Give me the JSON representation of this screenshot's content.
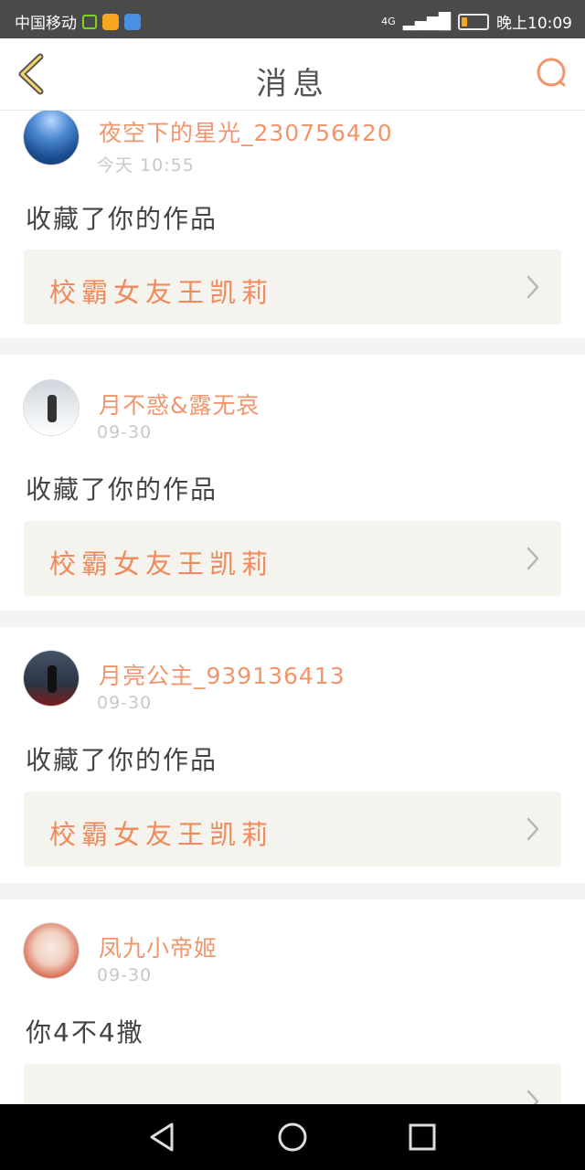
{
  "status_bar": {
    "carrier": "中国移动",
    "network": "4G",
    "time": "晚上10:09",
    "battery_level": 0.2
  },
  "header": {
    "title": "消息",
    "back_icon": "chevron-left-icon",
    "search_icon": "search-icon"
  },
  "messages": [
    {
      "username": "夜空下的星光_230756420",
      "time": "今天 10:55",
      "action": "收藏了你的作品",
      "work_title": "校霸女友王凯莉",
      "avatar": "sky-avatar"
    },
    {
      "username": "月不惑&露无哀",
      "time": "09-30",
      "action": "收藏了你的作品",
      "work_title": "校霸女友王凯莉",
      "avatar": "snow-avatar"
    },
    {
      "username": "月亮公主_939136413",
      "time": "09-30",
      "action": "收藏了你的作品",
      "work_title": "校霸女友王凯莉",
      "avatar": "night-avatar"
    },
    {
      "username": "凤九小帝姬",
      "time": "09-30",
      "action": "你4不4撒",
      "work_title": "",
      "avatar": "lady-avatar"
    }
  ],
  "colors": {
    "accent": "#f0956c",
    "link_bg": "#f4f3ee",
    "divider": "#f3f3f3"
  }
}
